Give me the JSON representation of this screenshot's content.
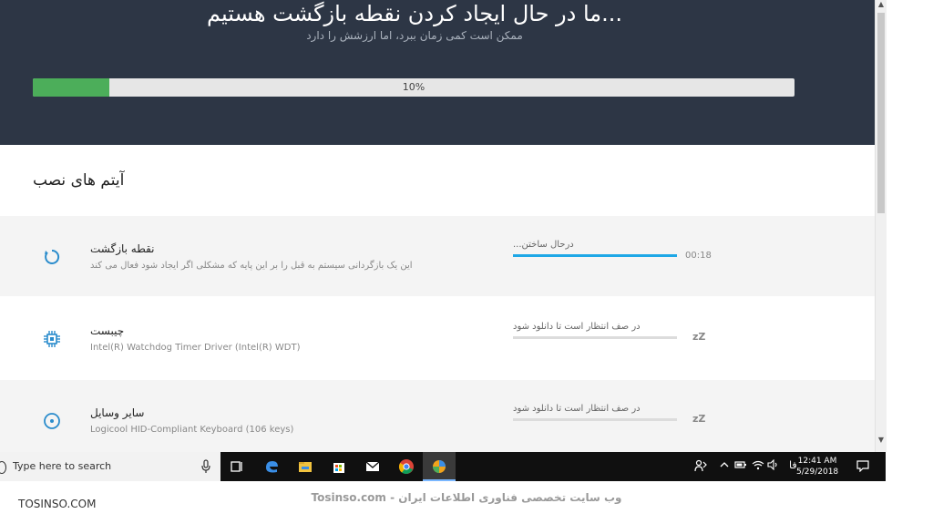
{
  "header": {
    "title": "...ما در حال ایجاد کردن نقطه بازگشت هستیم",
    "subtitle": "ممکن است کمی زمان ببرد، اما ارزشش را دارد",
    "progress_text": "10%",
    "progress_value": 0.1,
    "progress_color": "#4cae5a",
    "background_color": "#2d3645"
  },
  "section": {
    "title": "آیتم های نصب"
  },
  "items": [
    {
      "title": "نقطه بازگشت",
      "description": "این یک بازگردانی سیستم به قبل را بر این پایه که مشکلی اگر ایجاد شود فعال می کند",
      "status": "درحال ساختن...",
      "time": "00:18",
      "progress_value": 1.0,
      "icon": "spinner-icon"
    },
    {
      "title": "چیبست",
      "description": "Intel(R) Watchdog Timer Driver (Intel(R) WDT)",
      "status": "در صف انتظار است تا دانلود شود",
      "indicator": "zZ",
      "icon": "chip-icon"
    },
    {
      "title": "سایر وسایل",
      "description": "Logicool HID-Compliant Keyboard (106 keys)",
      "status": "در صف انتظار است تا دانلود شود",
      "indicator": "zZ",
      "icon": "disc-icon"
    }
  ],
  "taskbar": {
    "search_placeholder": "Type here to search",
    "language": "فا",
    "time": "12:41 AM",
    "date": "5/29/2018",
    "pinned": [
      "task-view-icon",
      "edge-icon",
      "file-explorer-icon",
      "store-icon",
      "mail-icon",
      "chrome-icon",
      "driver-app-icon"
    ]
  },
  "watermark": {
    "left": "TOSINSO.COM",
    "center": "Tosinso.com - وب سایت تخصصی فناوری اطلاعات ایران"
  }
}
